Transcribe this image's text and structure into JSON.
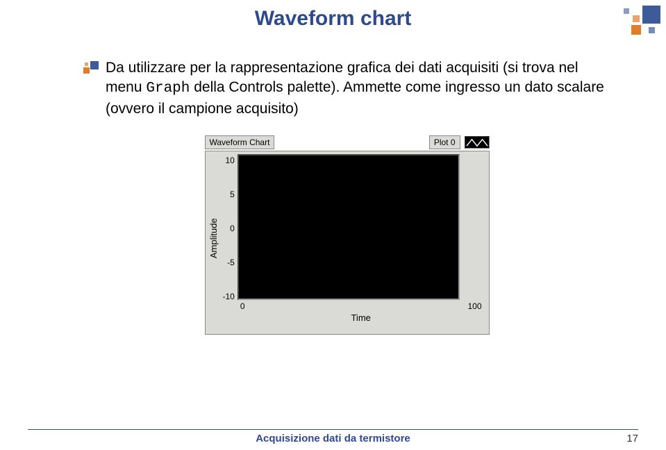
{
  "title": "Waveform chart",
  "bullet": {
    "part1": "Da utilizzare per la rappresentazione grafica dei dati acquisiti (si trova nel menu ",
    "code": "Graph",
    "part2": " della Controls palette). Ammette come ingresso un dato scalare (ovvero il campione acquisito)"
  },
  "chart_data": {
    "type": "line",
    "panel_label": "Waveform Chart",
    "legend": "Plot 0",
    "xlabel": "Time",
    "ylabel": "Amplitude",
    "xlim": [
      0,
      100
    ],
    "ylim": [
      -10,
      10
    ],
    "xticks": [
      "0",
      "100"
    ],
    "yticks": [
      "10",
      "5",
      "0",
      "-5",
      "-10"
    ],
    "series": [
      {
        "name": "Plot 0",
        "values": []
      }
    ]
  },
  "footer": {
    "text": "Acquisizione dati da termistore",
    "page": "17"
  }
}
